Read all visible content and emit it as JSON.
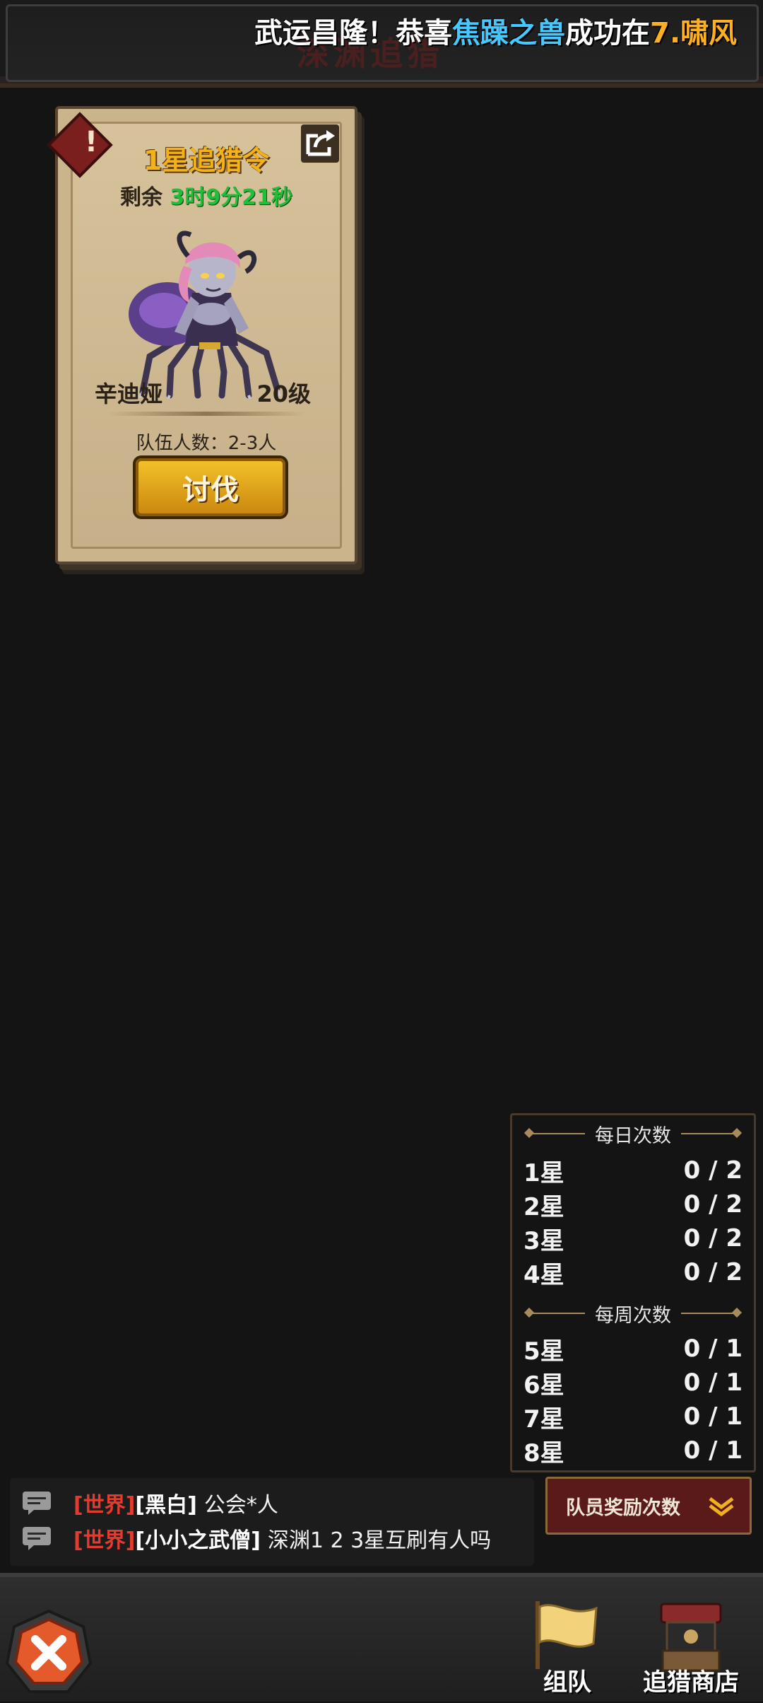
{
  "header": {
    "title": "深渊追猎",
    "marquee": {
      "part1": "武运昌隆！恭喜",
      "player": "焦躁之兽",
      "part2": "成功在",
      "part3": "7.啸风"
    }
  },
  "card": {
    "title": "1星追猎令",
    "remaining_label": "剩余",
    "remaining_time": "3时9分21秒",
    "monster_name": "辛迪娅",
    "monster_level": "20级",
    "team_size": "队伍人数：2-3人",
    "attack_label": "讨伐",
    "alert_mark": "!"
  },
  "counts": {
    "daily_title": "每日次数",
    "daily": [
      {
        "star": "1星",
        "count": "0 / 2"
      },
      {
        "star": "2星",
        "count": "0 / 2"
      },
      {
        "star": "3星",
        "count": "0 / 2"
      },
      {
        "star": "4星",
        "count": "0 / 2"
      }
    ],
    "weekly_title": "每周次数",
    "weekly": [
      {
        "star": "5星",
        "count": "0 / 1"
      },
      {
        "star": "6星",
        "count": "0 / 1"
      },
      {
        "star": "7星",
        "count": "0 / 1"
      },
      {
        "star": "8星",
        "count": "0 / 1"
      }
    ]
  },
  "reward_button": "队员奖励次数",
  "chat": [
    {
      "channel": "[世界]",
      "user": "[黑白]",
      "text": "公会*人"
    },
    {
      "channel": "[世界]",
      "user": "[小小之武僧]",
      "text": "深渊1 2 3星互刷有人吗"
    }
  ],
  "bottom": {
    "team_label": "组队",
    "shop_label": "追猎商店"
  },
  "colors": {
    "accent_gold": "#f4b21a",
    "timer_green": "#1fbf3a",
    "chat_channel_red": "#e33b2e",
    "marquee_blue": "#47c8ff",
    "marquee_orange": "#ffb020"
  }
}
